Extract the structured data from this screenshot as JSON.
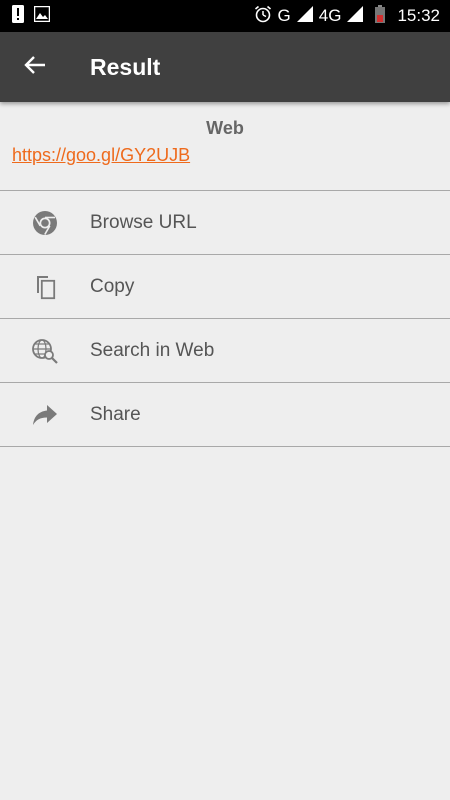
{
  "status_bar": {
    "network_label": "G",
    "network2_label": "4G",
    "time": "15:32"
  },
  "app_bar": {
    "title": "Result"
  },
  "result": {
    "type": "Web",
    "url": "https://goo.gl/GY2UJB",
    "link_color": "#ee6a1c"
  },
  "actions": [
    {
      "label": "Browse URL",
      "icon": "chrome-icon"
    },
    {
      "label": "Copy",
      "icon": "copy-icon"
    },
    {
      "label": "Search in Web",
      "icon": "web-search-icon"
    },
    {
      "label": "Share",
      "icon": "share-icon"
    }
  ]
}
